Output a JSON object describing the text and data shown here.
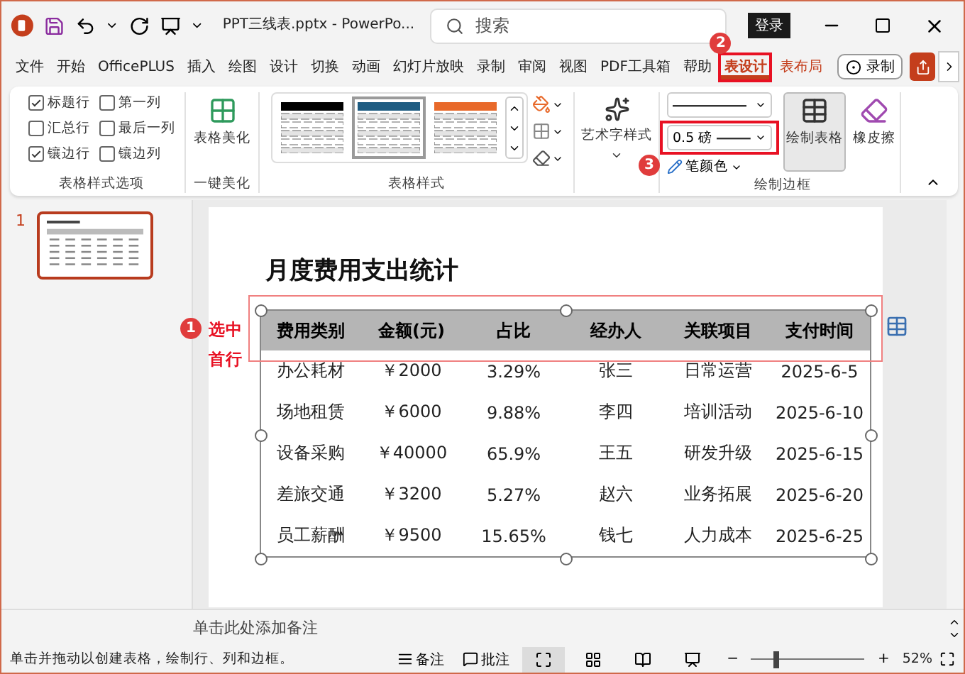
{
  "window": {
    "filename": "PPT三线表.pptx  -  PowerPo...",
    "search_placeholder": "搜索",
    "login": "登录"
  },
  "ribbon_tabs": [
    {
      "label": "文件",
      "selected": false,
      "contextual": false
    },
    {
      "label": "开始",
      "selected": false,
      "contextual": false
    },
    {
      "label": "OfficePLUS",
      "selected": false,
      "contextual": false
    },
    {
      "label": "插入",
      "selected": false,
      "contextual": false
    },
    {
      "label": "绘图",
      "selected": false,
      "contextual": false
    },
    {
      "label": "设计",
      "selected": false,
      "contextual": false
    },
    {
      "label": "切换",
      "selected": false,
      "contextual": false
    },
    {
      "label": "动画",
      "selected": false,
      "contextual": false
    },
    {
      "label": "幻灯片放映",
      "selected": false,
      "contextual": false
    },
    {
      "label": "录制",
      "selected": false,
      "contextual": false
    },
    {
      "label": "审阅",
      "selected": false,
      "contextual": false
    },
    {
      "label": "视图",
      "selected": false,
      "contextual": false
    },
    {
      "label": "PDF工具箱",
      "selected": false,
      "contextual": false
    },
    {
      "label": "帮助",
      "selected": false,
      "contextual": false
    },
    {
      "label": "表设计",
      "selected": true,
      "contextual": true,
      "highlighted": true,
      "callout": "2"
    },
    {
      "label": "表布局",
      "selected": false,
      "contextual": true
    }
  ],
  "record_button": "录制",
  "ribbon": {
    "style_options": {
      "label": "表格样式选项",
      "checkboxes": [
        {
          "label": "标题行",
          "checked": true
        },
        {
          "label": "第一列",
          "checked": false
        },
        {
          "label": "汇总行",
          "checked": false
        },
        {
          "label": "最后一列",
          "checked": false
        },
        {
          "label": "镶边行",
          "checked": true
        },
        {
          "label": "镶边列",
          "checked": false
        }
      ]
    },
    "beautify": {
      "button": "表格美化",
      "label": "一键美化"
    },
    "table_styles": {
      "label": "表格样式",
      "styles": [
        {
          "color": "#000000",
          "selected": false
        },
        {
          "color": "#1f5c82",
          "selected": true
        },
        {
          "color": "#e8692a",
          "selected": false
        }
      ]
    },
    "wordart": {
      "button": "艺术字样式"
    },
    "draw_borders": {
      "label": "绘制边框",
      "pen_weight": {
        "value": "0.5 磅",
        "highlighted": true,
        "callout": "3"
      },
      "pen_color": "笔颜色",
      "draw_table": {
        "label": "绘制表格",
        "on": true
      },
      "eraser": "橡皮擦"
    }
  },
  "thumbnails": [
    {
      "number": "1",
      "selected": true
    }
  ],
  "slide": {
    "title": "月度费用支出统计",
    "callout": {
      "number": "1",
      "text": "选中首行"
    },
    "table": {
      "columns": [
        "费用类别",
        "金额(元)",
        "占比",
        "经办人",
        "关联项目",
        "支付时间"
      ],
      "rows": [
        [
          "办公耗材",
          "￥2000",
          "3.29%",
          "张三",
          "日常运营",
          "2025-6-5"
        ],
        [
          "场地租赁",
          "￥6000",
          "9.88%",
          "李四",
          "培训活动",
          "2025-6-10"
        ],
        [
          "设备采购",
          "￥40000",
          "65.9%",
          "王五",
          "研发升级",
          "2025-6-15"
        ],
        [
          "差旅交通",
          "￥3200",
          "5.27%",
          "赵六",
          "业务拓展",
          "2025-6-20"
        ],
        [
          "员工薪酬",
          "￥9500",
          "15.65%",
          "钱七",
          "人力成本",
          "2025-6-25"
        ]
      ]
    }
  },
  "notes_placeholder": "单击此处添加备注",
  "status_bar": {
    "message": "单击并拖动以创建表格，绘制行、列和边框。",
    "notes": "备注",
    "comments": "批注",
    "views": [
      {
        "kind": "normal",
        "selected": true
      },
      {
        "kind": "sorter",
        "selected": false
      },
      {
        "kind": "reading",
        "selected": false
      },
      {
        "kind": "slideshow",
        "selected": false
      }
    ],
    "zoom_out": "−",
    "zoom_in": "+",
    "zoom": {
      "level": 0.22,
      "reading": "52%"
    }
  }
}
